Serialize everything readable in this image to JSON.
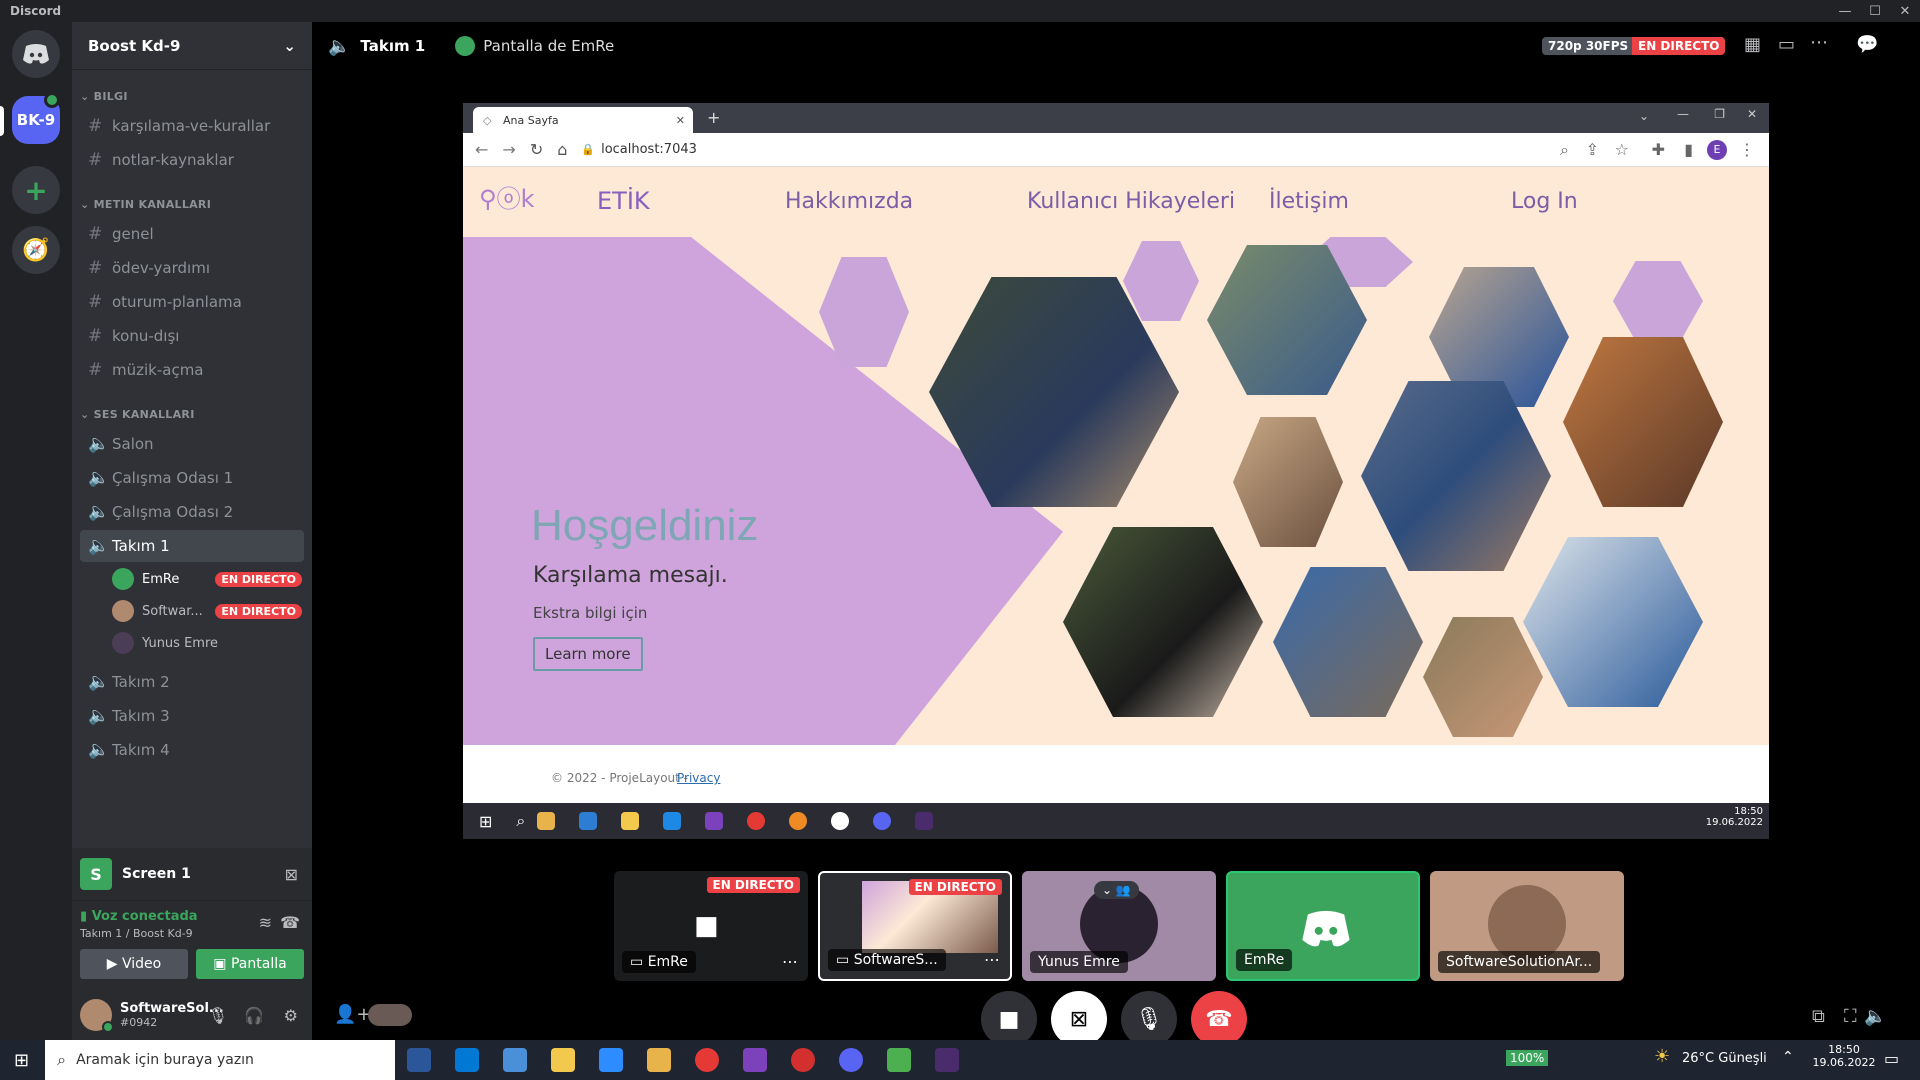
{
  "app": {
    "title": "Discord"
  },
  "server": {
    "name": "Boost Kd-9",
    "abbr": "BK-9",
    "categories": [
      {
        "name": "BILGI",
        "channels": [
          "karşılama-ve-kurallar",
          "notlar-kaynaklar"
        ]
      },
      {
        "name": "METIN KANALLARI",
        "channels": [
          "genel",
          "ödev-yardımı",
          "oturum-planlama",
          "konu-dışı",
          "müzik-açma"
        ]
      },
      {
        "name": "SES KANALLARI",
        "channels": [
          "Salon",
          "Çalışma Odası 1",
          "Çalışma Odası 2",
          "Takım 1",
          "Takım 2",
          "Takım 3",
          "Takım 4"
        ]
      }
    ],
    "voice_users": [
      {
        "name": "EmRe",
        "badge": "EN DIRECTO"
      },
      {
        "name": "Softwar...",
        "badge": "EN DIRECTO"
      },
      {
        "name": "Yunus Emre",
        "badge": ""
      }
    ]
  },
  "panel": {
    "screen_label": "Screen 1",
    "voice_status": "Voz conectada",
    "voice_location": "Takım 1 / Boost Kd-9",
    "video_btn": "Video",
    "screen_btn": "Pantalla",
    "username": "SoftwareSol...",
    "tag": "#0942"
  },
  "header": {
    "channel": "Takım 1",
    "stream_title": "Pantalla de EmRe",
    "quality": "720p 30FPS",
    "live": "EN DIRECTO"
  },
  "browser": {
    "tab_title": "Ana Sayfa",
    "url": "localhost:7043",
    "avatar_letter": "E",
    "site": {
      "logo_text": "ETİK",
      "nav": [
        "Hakkımızda",
        "Kullanıcı Hikayeleri",
        "İletişim",
        "Log In"
      ],
      "hero_title": "Hoşgeldiniz",
      "hero_sub": "Karşılama mesajı.",
      "hero_text": "Ekstra bilgi için",
      "hero_button": "Learn more",
      "footer_text": "© 2022 - ProjeLayout -",
      "footer_link": "Privacy"
    },
    "taskbar_time": "18:50",
    "taskbar_date": "19.06.2022"
  },
  "tiles": [
    {
      "label": "EmRe",
      "live": "EN DIRECTO"
    },
    {
      "label": "SoftwareS...",
      "live": "EN DIRECTO"
    },
    {
      "label": "Yunus Emre",
      "live": ""
    },
    {
      "label": "EmRe",
      "live": ""
    },
    {
      "label": "SoftwareSolutionAr...",
      "live": ""
    }
  ],
  "taskbar": {
    "search_placeholder": "Aramak için buraya yazın",
    "battery": "100%",
    "weather": "26°C  Güneşli",
    "time": "18:50",
    "date": "19.06.2022"
  },
  "colors": {
    "accent": "#5865f2",
    "live": "#ed4245",
    "green": "#3ba55d",
    "hero_purple": "#cfa4dc"
  }
}
